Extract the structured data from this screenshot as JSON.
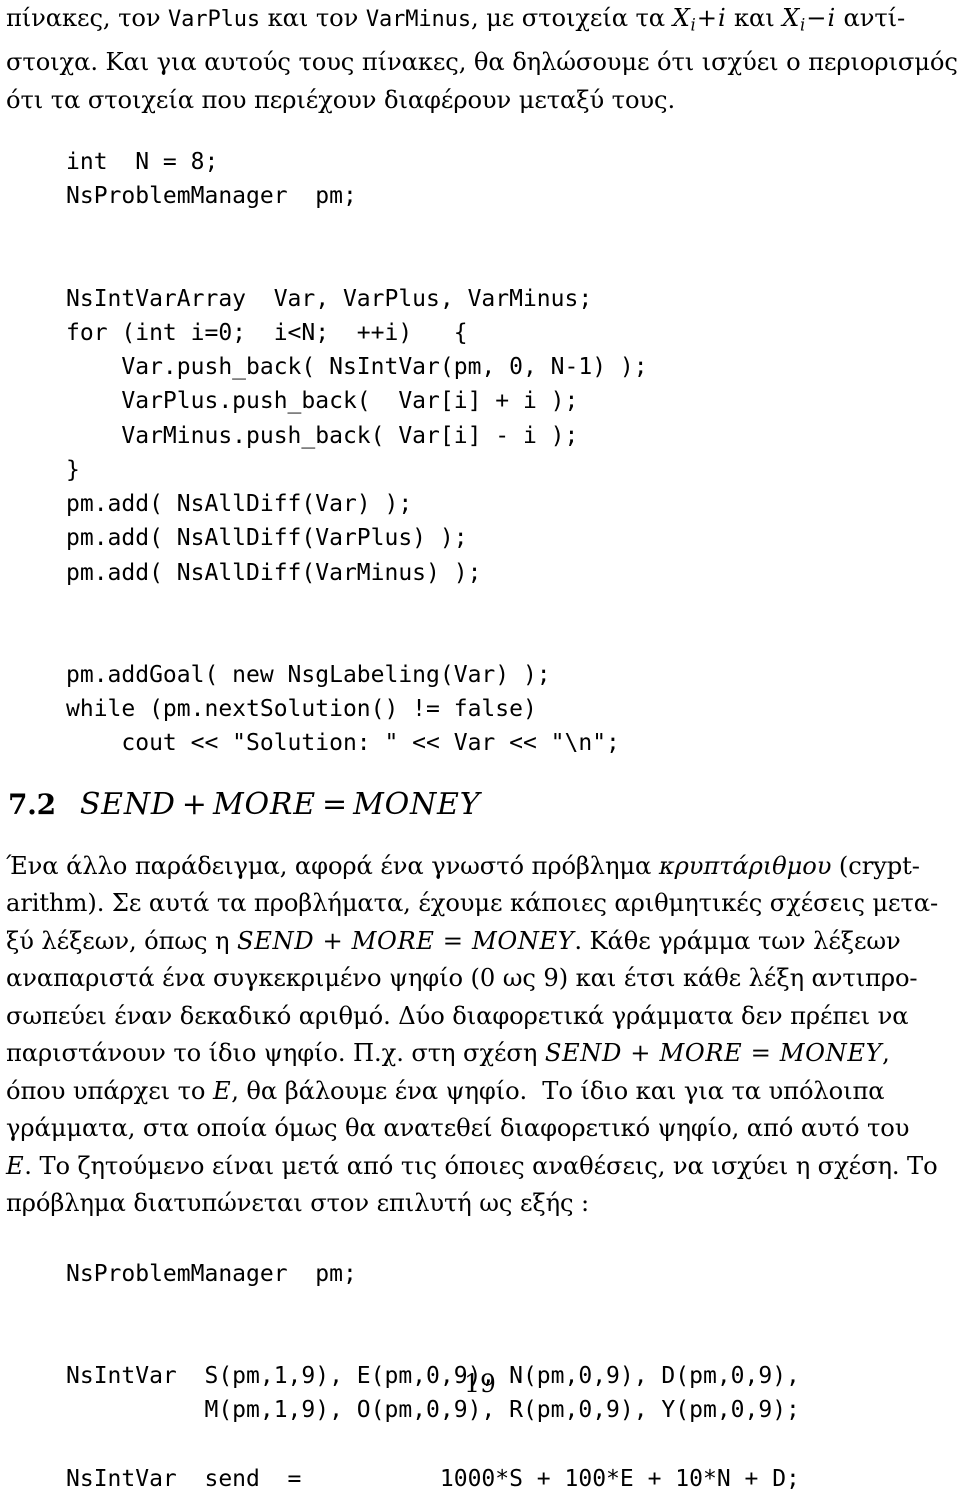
{
  "document": {
    "page_number": "19",
    "language": "Greek"
  },
  "intro_paragraph": {
    "line1_a": "πίνακες, τον ",
    "line1_code1": "VarPlus",
    "line1_b": " και τον ",
    "line1_code2": "VarMinus",
    "line1_c": ", με στοιχεία τα ",
    "line1_math1_base": "X",
    "line1_math1_sub": "i",
    "line1_math1_op": "+",
    "line1_math1_term": "i",
    "line1_d": " και ",
    "line1_math2_base": "X",
    "line1_math2_sub": "i",
    "line1_math2_op": "−",
    "line1_math2_term": "i",
    "line1_e": " αντί-",
    "line2": "στοιχα. Και για αυτούς τους πίνακες, θα δηλώσουμε ότι ισχύει ο περιορισμός",
    "line3": "ότι τα στοιχεία που περιέχουν διαφέρουν μεταξύ τους."
  },
  "code_block_1": {
    "lines": [
      "int  N = 8;",
      "NsProblemManager  pm;",
      "",
      "",
      "NsIntVarArray  Var, VarPlus, VarMinus;",
      "for (int i=0;  i<N;  ++i)   {",
      "    Var.push_back( NsIntVar(pm, 0, N-1) );",
      "    VarPlus.push_back(  Var[i] + i );",
      "    VarMinus.push_back( Var[i] - i );",
      "}",
      "pm.add( NsAllDiff(Var) );",
      "pm.add( NsAllDiff(VarPlus) );",
      "pm.add( NsAllDiff(VarMinus) );",
      "",
      "",
      "pm.addGoal( new NsgLabeling(Var) );",
      "while (pm.nextSolution() != false)",
      "    cout << \"Solution: \" << Var << \"\\n\";"
    ]
  },
  "section": {
    "number": "7.2",
    "title_tokens": [
      "SEND",
      "+",
      "MORE",
      "=",
      "MONEY"
    ],
    "title_plain": "SEND + MORE = MONEY"
  },
  "body_paragraph": {
    "line1_a": "Ένα άλλο παράδειγμα, αφορά ένα γνωστό πρόβλημα ",
    "line1_it": "κρυπτάριθμου",
    "line1_b": " (crypt-",
    "line2": "arithm). Σε αυτά τα προβλήματα, έχουμε κάποιες αριθμητικές σχέσεις μετα-",
    "line3_a": "ξύ λέξεων, όπως η ",
    "line3_math": "SEND + MORE = MONEY",
    "line3_b": ". Κάθε γράμμα των λέξεων",
    "line4": "αναπαριστά ένα συγκεκριμένο ψηφίο (0 ως 9) και έτσι κάθε λέξη αντιπρο-",
    "line5": "σωπεύει έναν δεκαδικό αριθμό.  Δύο διαφορετικά γράμματα δεν πρέπει να",
    "line6_a": "παριστάνουν το ίδιο ψηφίο. Π.χ. στη σχέση ",
    "line6_math": "SEND + MORE = MONEY",
    "line6_b": ",",
    "line7_a": "όπου υπάρχει το ",
    "line7_math": "E",
    "line7_b": ", θα βάλουμε ένα ψηφίο.  Το ίδιο και για τα υπόλοιπα",
    "line8": "γράμματα, στα οποία όμως θα ανατεθεί διαφορετικό ψηφίο, από αυτό του",
    "line9_math": "E",
    "line9_a": ". Το ζητούμενο είναι μετά από τις όποιες αναθέσεις, να ισχύει η σχέση. Το",
    "line10": "πρόβλημα διατυπώνεται στον επιλυτή ως εξής :"
  },
  "code_block_2": {
    "lines": [
      "NsProblemManager  pm;",
      "",
      "",
      "NsIntVar  S(pm,1,9), E(pm,0,9), N(pm,0,9), D(pm,0,9),",
      "          M(pm,1,9), O(pm,0,9), R(pm,0,9), Y(pm,0,9);",
      "",
      "NsIntVar  send  =          1000*S + 100*E + 10*N + D;"
    ]
  }
}
